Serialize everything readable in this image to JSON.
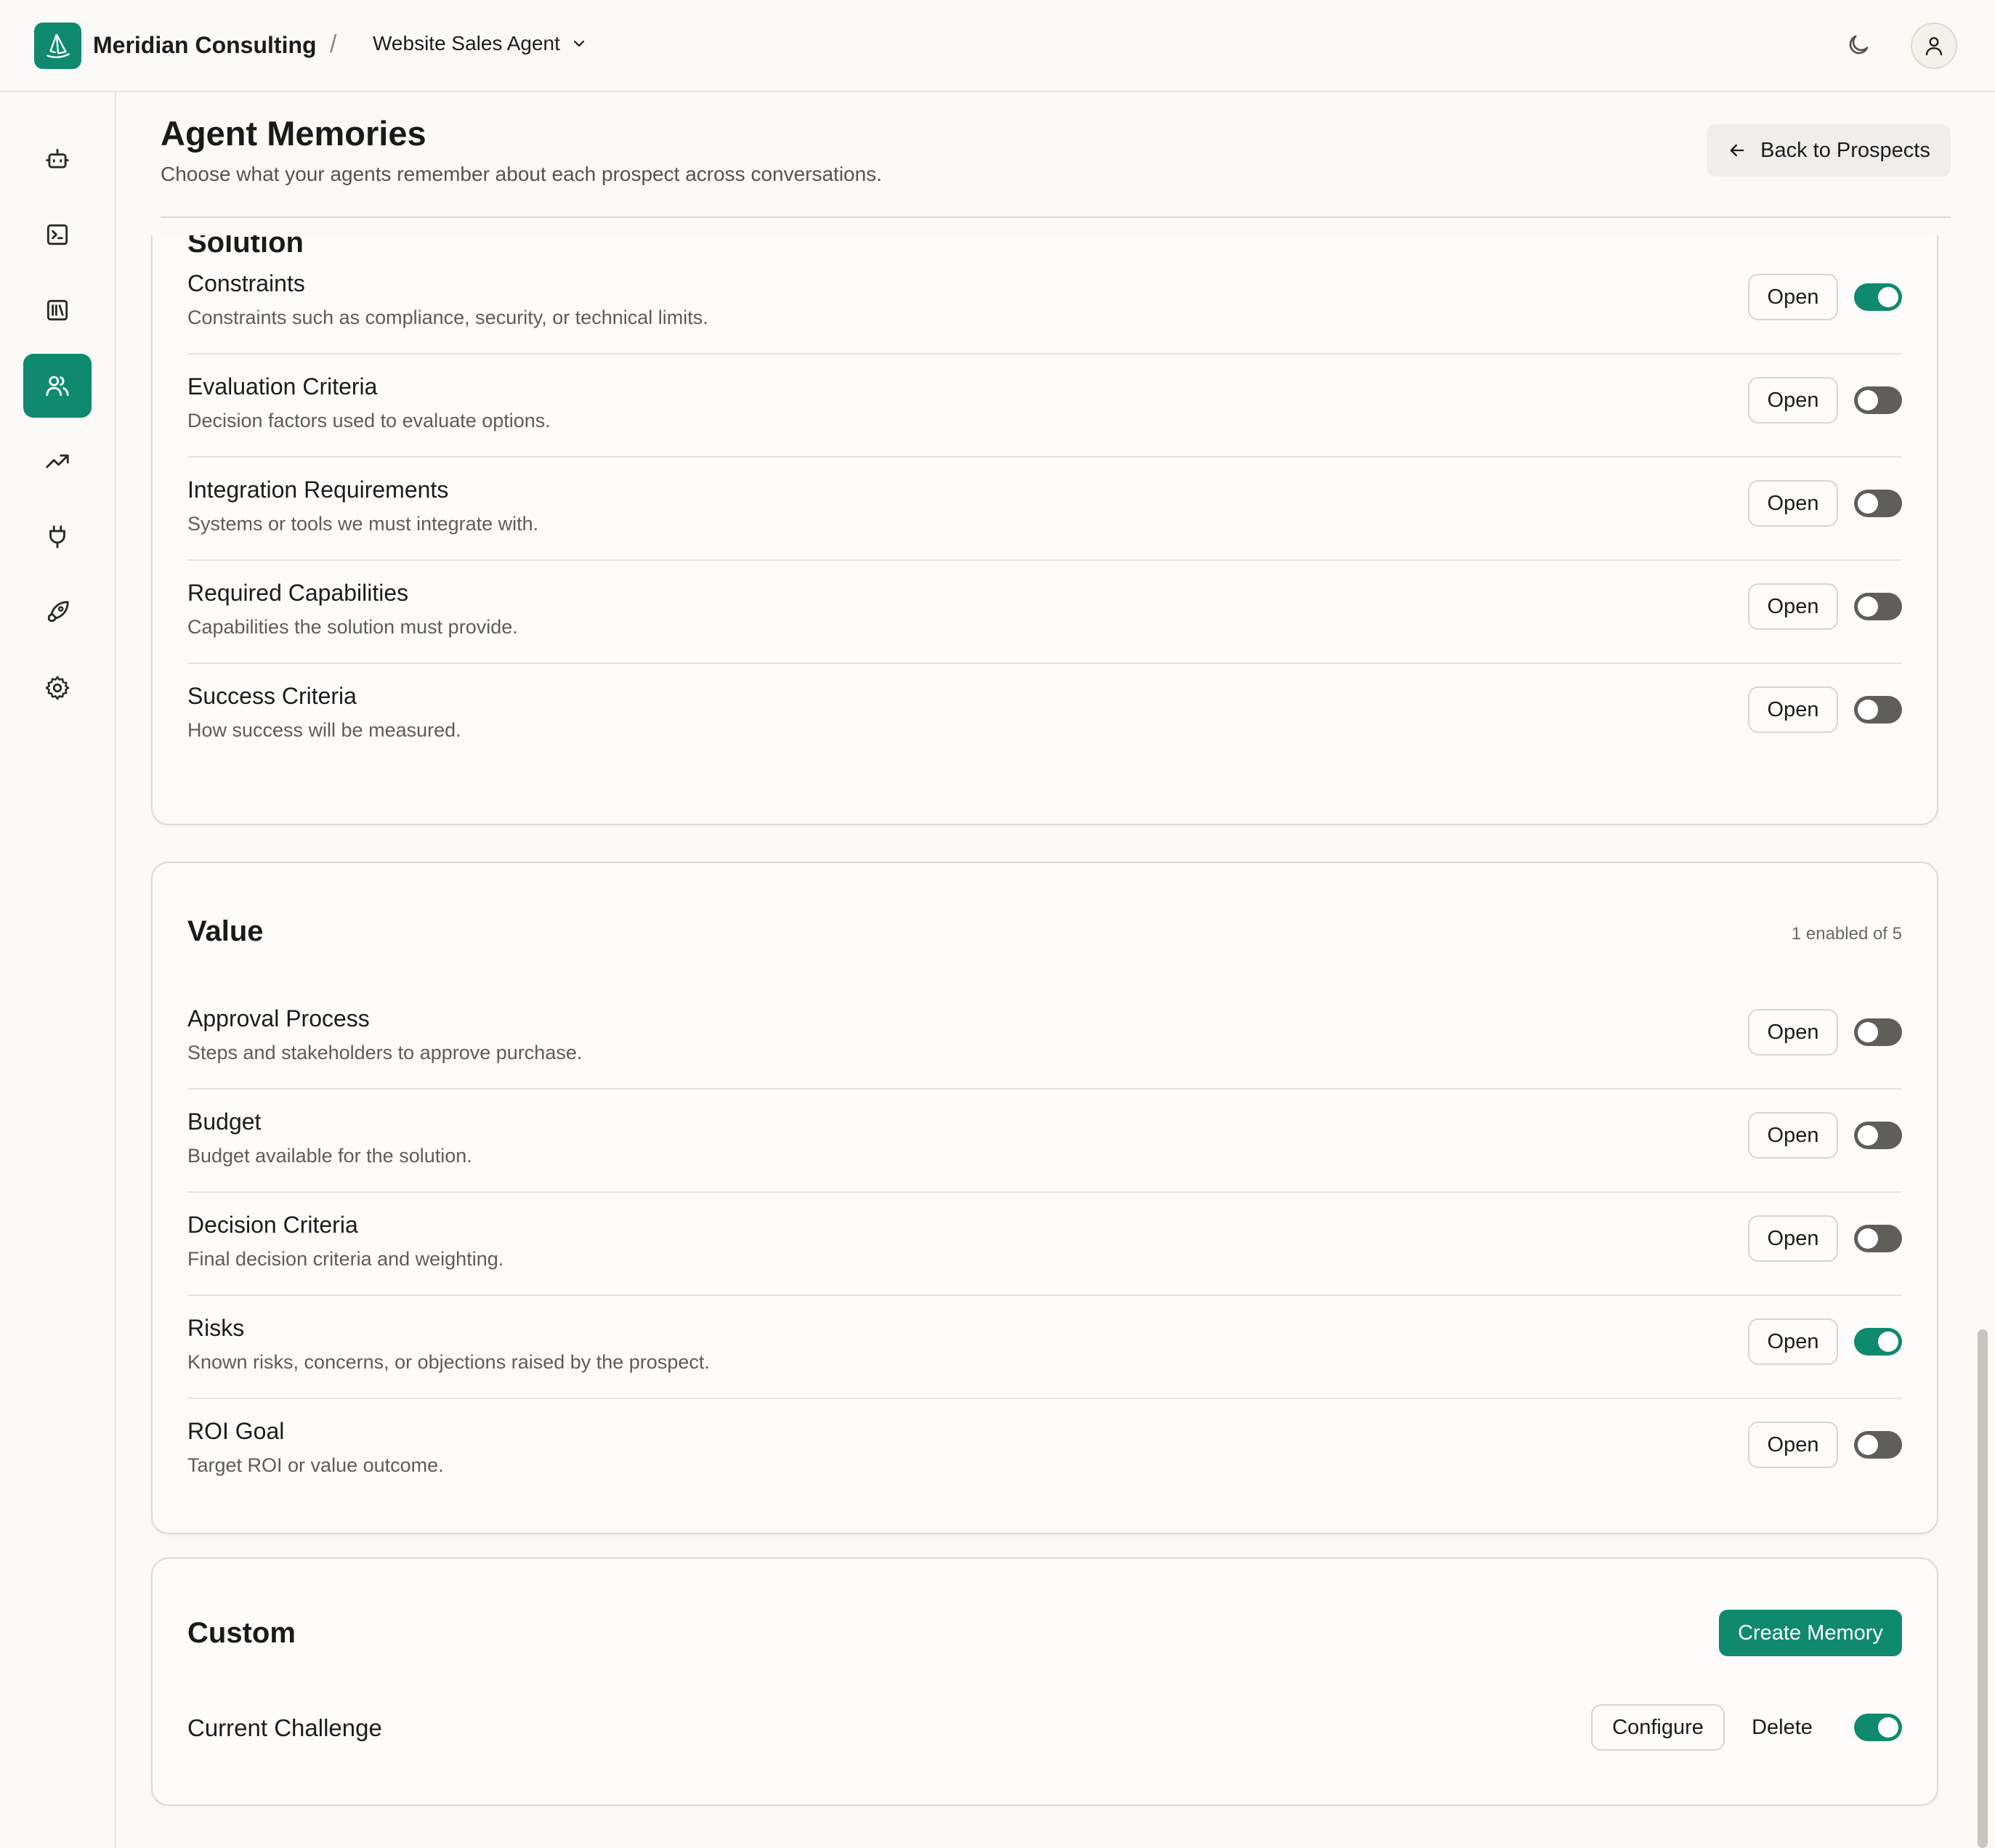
{
  "header": {
    "org_name": "Meridian Consulting",
    "separator": "/",
    "agent_name": "Website Sales Agent"
  },
  "sidebar": {
    "items": [
      {
        "icon": "bot-icon",
        "active": false
      },
      {
        "icon": "terminal-icon",
        "active": false
      },
      {
        "icon": "library-icon",
        "active": false
      },
      {
        "icon": "users-icon",
        "active": true
      },
      {
        "icon": "trending-up-icon",
        "active": false
      },
      {
        "icon": "plug-icon",
        "active": false
      },
      {
        "icon": "rocket-icon",
        "active": false
      },
      {
        "icon": "gear-icon",
        "active": false
      }
    ]
  },
  "page": {
    "title": "Agent Memories",
    "subtitle": "Choose what your agents remember about each prospect across conversations.",
    "back_button": "Back to Prospects"
  },
  "solution_section": {
    "title": "Solution",
    "rows": [
      {
        "name": "Constraints",
        "desc": "Constraints such as compliance, security, or technical limits.",
        "open": "Open",
        "enabled": true
      },
      {
        "name": "Evaluation Criteria",
        "desc": "Decision factors used to evaluate options.",
        "open": "Open",
        "enabled": false
      },
      {
        "name": "Integration Requirements",
        "desc": "Systems or tools we must integrate with.",
        "open": "Open",
        "enabled": false
      },
      {
        "name": "Required Capabilities",
        "desc": "Capabilities the solution must provide.",
        "open": "Open",
        "enabled": false
      },
      {
        "name": "Success Criteria",
        "desc": "How success will be measured.",
        "open": "Open",
        "enabled": false
      }
    ]
  },
  "value_section": {
    "title": "Value",
    "meta": "1 enabled of 5",
    "rows": [
      {
        "name": "Approval Process",
        "desc": "Steps and stakeholders to approve purchase.",
        "open": "Open",
        "enabled": false
      },
      {
        "name": "Budget",
        "desc": "Budget available for the solution.",
        "open": "Open",
        "enabled": false
      },
      {
        "name": "Decision Criteria",
        "desc": "Final decision criteria and weighting.",
        "open": "Open",
        "enabled": false
      },
      {
        "name": "Risks",
        "desc": "Known risks, concerns, or objections raised by the prospect.",
        "open": "Open",
        "enabled": true
      },
      {
        "name": "ROI Goal",
        "desc": "Target ROI or value outcome.",
        "open": "Open",
        "enabled": false
      }
    ]
  },
  "custom_section": {
    "title": "Custom",
    "create_button": "Create Memory",
    "rows": [
      {
        "name": "Current Challenge",
        "configure": "Configure",
        "delete": "Delete",
        "enabled": true
      }
    ]
  },
  "colors": {
    "accent": "#0f8a6e",
    "toggle_off": "#5f5e5b",
    "background": "#fbfaf7"
  }
}
